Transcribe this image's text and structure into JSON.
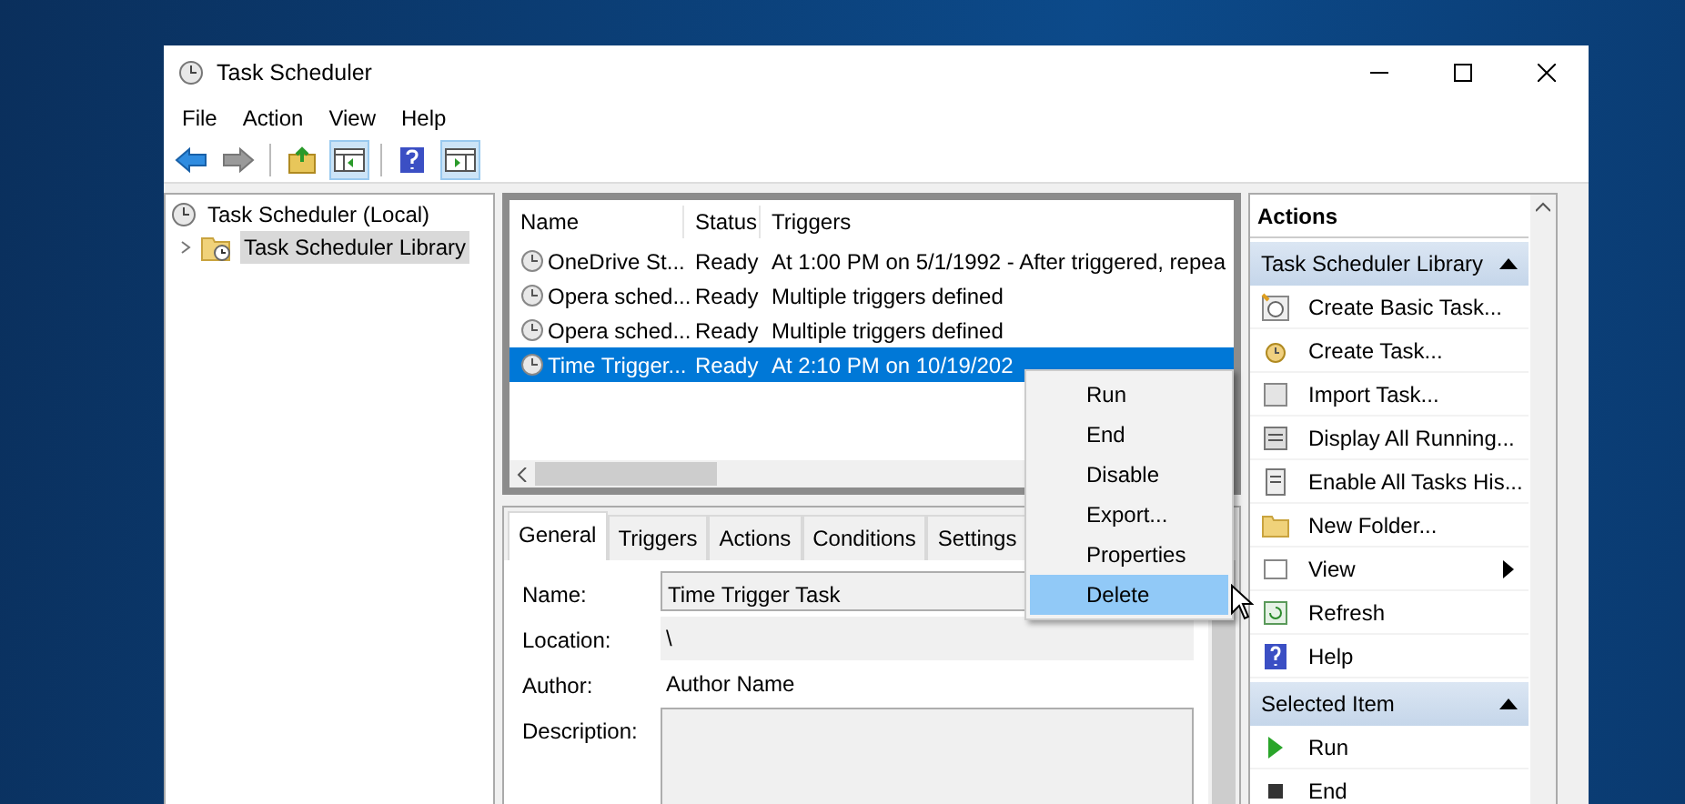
{
  "window": {
    "title": "Task Scheduler"
  },
  "menu": [
    "File",
    "Action",
    "View",
    "Help"
  ],
  "tree": [
    {
      "label": "Task Scheduler (Local)",
      "selected": false,
      "children": [
        {
          "label": "Task Scheduler Library",
          "selected": true,
          "expanded": false
        }
      ]
    }
  ],
  "tasks": {
    "columns": [
      "Name",
      "Status",
      "Triggers"
    ],
    "rows": [
      {
        "name": "OneDrive St...",
        "status": "Ready",
        "trigger": "At 1:00 PM on 5/1/1992 - After triggered, repea",
        "selected": false
      },
      {
        "name": "Opera sched...",
        "status": "Ready",
        "trigger": "Multiple triggers defined",
        "selected": false
      },
      {
        "name": "Opera sched...",
        "status": "Ready",
        "trigger": "Multiple triggers defined",
        "selected": false
      },
      {
        "name": "Time Trigger...",
        "status": "Ready",
        "trigger": "At 2:10 PM on 10/19/202",
        "selected": true
      }
    ]
  },
  "details": {
    "tabs": [
      {
        "label": "General",
        "selected": true
      },
      {
        "label": "Triggers",
        "selected": false
      },
      {
        "label": "Actions",
        "selected": false
      },
      {
        "label": "Conditions",
        "selected": false
      },
      {
        "label": "Settings",
        "selected": false
      }
    ],
    "fields": [
      {
        "label": "Name:",
        "value": "Time Trigger Task",
        "kind": "box"
      },
      {
        "label": "Location:",
        "value": "\\",
        "kind": "readonly"
      },
      {
        "label": "Author:",
        "value": "Author Name",
        "kind": "plain"
      },
      {
        "label": "Description:",
        "kind": "area"
      }
    ]
  },
  "context_menu": [
    {
      "label": "Run",
      "selected": false
    },
    {
      "label": "End",
      "selected": false
    },
    {
      "label": "Disable",
      "selected": false
    },
    {
      "label": "Export...",
      "selected": false
    },
    {
      "label": "Properties",
      "selected": false
    },
    {
      "label": "Delete",
      "selected": true
    }
  ],
  "actions": {
    "title": "Actions",
    "sections": [
      {
        "header": "Task Scheduler Library",
        "items": [
          {
            "label": "Create Basic Task...",
            "submenu": false
          },
          {
            "label": "Create Task...",
            "submenu": false
          },
          {
            "label": "Import Task...",
            "submenu": false
          },
          {
            "label": "Display All Running...",
            "submenu": false
          },
          {
            "label": "Enable All Tasks His...",
            "submenu": false
          },
          {
            "label": "New Folder...",
            "submenu": false
          },
          {
            "label": "View",
            "submenu": true
          },
          {
            "label": "Refresh",
            "submenu": false
          },
          {
            "label": "Help",
            "submenu": false
          }
        ]
      },
      {
        "header": "Selected Item",
        "items": [
          {
            "label": "Run",
            "submenu": false
          },
          {
            "label": "End",
            "submenu": false
          }
        ]
      }
    ]
  }
}
